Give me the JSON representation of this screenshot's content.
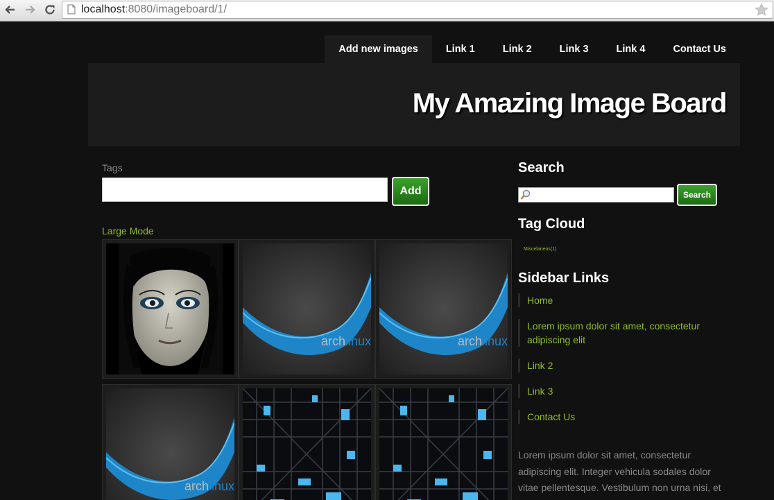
{
  "browser": {
    "url_host": "localhost",
    "url_rest": ":8080/imageboard/1/"
  },
  "nav": {
    "items": [
      {
        "label": "Add new images",
        "active": true
      },
      {
        "label": "Link 1",
        "active": false
      },
      {
        "label": "Link 2",
        "active": false
      },
      {
        "label": "Link 3",
        "active": false
      },
      {
        "label": "Link 4",
        "active": false
      },
      {
        "label": "Contact Us",
        "active": false
      }
    ]
  },
  "header": {
    "title": "My Amazing Image Board"
  },
  "form": {
    "tags_label": "Tags",
    "tags_value": "",
    "add_label": "Add"
  },
  "gallery": {
    "mode_link": "Large Mode",
    "images": [
      {
        "kind": "face"
      },
      {
        "kind": "archlinux"
      },
      {
        "kind": "archlinux"
      },
      {
        "kind": "archlinux"
      },
      {
        "kind": "cubes"
      },
      {
        "kind": "cubes"
      }
    ]
  },
  "sidebar": {
    "search_heading": "Search",
    "search_value": "",
    "search_button": "Search",
    "tagcloud_heading": "Tag Cloud",
    "tagcloud_items": [
      "Miscelaneos(1)"
    ],
    "links_heading": "Sidebar Links",
    "links": [
      "Home",
      "Lorem ipsum dolor sit amet, consectetur adipiscing elit",
      "Link 2",
      "Link 3",
      "Contact Us"
    ],
    "paragraph": "Lorem ipsum dolor sit amet, consectetur adipiscing elit. Integer vehicula sodales dolor vitae pellentesque. Vestibulum non urna nisi, et"
  },
  "colors": {
    "accent_green": "#8fbd2a",
    "button_green": "#2c8a1e",
    "page_bg": "#111111",
    "banner_bg": "#1c1c1c"
  }
}
